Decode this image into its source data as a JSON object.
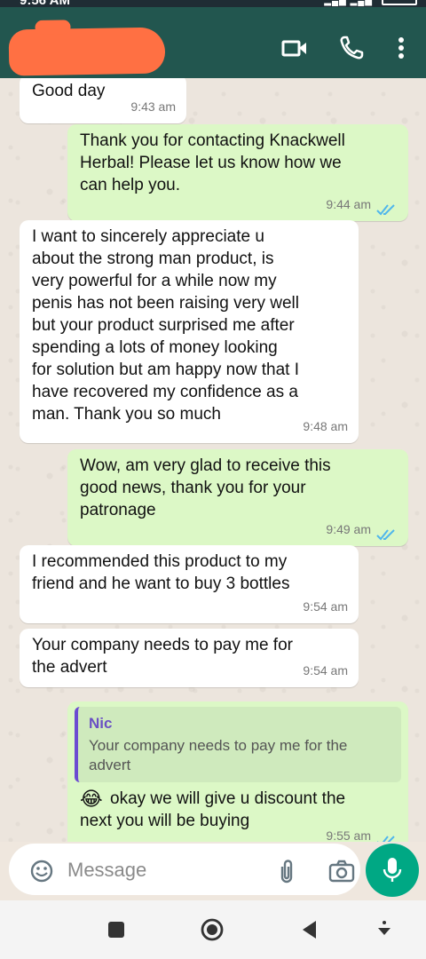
{
  "status_bar": {
    "time": "9:56 AM"
  },
  "header": {
    "contact_name": "",
    "icons": [
      "video-call-icon",
      "voice-call-icon",
      "more-options-icon"
    ]
  },
  "messages": [
    {
      "direction": "in",
      "text": "Good day",
      "time": "9:43 am"
    },
    {
      "direction": "out",
      "text": "Thank you for contacting Knackwell\nHerbal! Please let us know how we\ncan help you.",
      "time": "9:44 am",
      "status": "read"
    },
    {
      "direction": "in",
      "text": "I want to sincerely appreciate u\nabout the strong man product,  is\nvery powerful for a while now my\npenis has not been raising very well\nbut your product surprised me after\nspending a lots of money looking\nfor solution but am happy now that I\nhave recovered my confidence as a\nman. Thank you so much",
      "time": "9:48 am"
    },
    {
      "direction": "out",
      "text": "Wow, am very glad to receive this\ngood news, thank you for your\npatronage",
      "time": "9:49 am",
      "status": "read"
    },
    {
      "direction": "in",
      "text": "I recommended this product to my\nfriend and he want to buy 3 bottles",
      "time": "9:54 am"
    },
    {
      "direction": "in",
      "text": "Your company needs to pay me for\nthe advert",
      "time": "9:54 am"
    },
    {
      "direction": "out",
      "quote_author": "Nic",
      "quote_text": "Your company needs to pay me for the\nadvert",
      "emoji": "😂",
      "text": "okay we will give u discount the\nnext you will be buying",
      "time": "9:55 am",
      "status": "read"
    }
  ],
  "composer": {
    "placeholder": "Message"
  },
  "colors": {
    "header": "#22564f",
    "outgoing_bubble": "#dcf8c6",
    "incoming_bubble": "#ffffff",
    "mic_button": "#00a884",
    "read_ticks": "#4fb6ec",
    "quote_bar": "#6c4bd1",
    "redaction": "#ff7043"
  }
}
